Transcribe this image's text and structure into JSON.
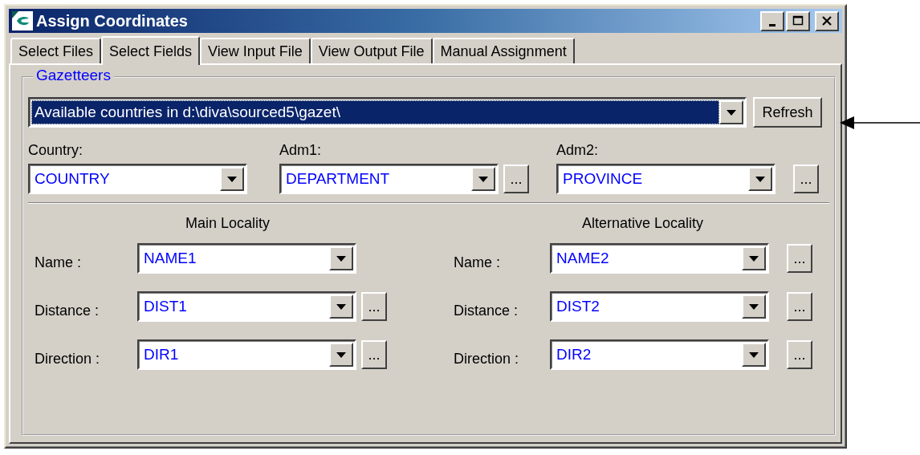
{
  "window": {
    "title": "Assign Coordinates"
  },
  "tabs": [
    {
      "label": "Select Files",
      "selected": false
    },
    {
      "label": "Select Fields",
      "selected": true
    },
    {
      "label": "View Input File",
      "selected": false
    },
    {
      "label": "View Output File",
      "selected": false
    },
    {
      "label": "Manual Assignment",
      "selected": false
    }
  ],
  "gazetteers": {
    "legend": "Gazetteers",
    "source": {
      "value": "Available countries in d:\\diva\\sourced5\\gazet\\",
      "focused": true
    },
    "refresh": "Refresh"
  },
  "admin": [
    {
      "label": "Country:",
      "value": "COUNTRY"
    },
    {
      "label": "Adm1:",
      "value": "DEPARTMENT",
      "browse": "..."
    },
    {
      "label": "Adm2:",
      "value": "PROVINCE",
      "browse": "..."
    }
  ],
  "localities": [
    {
      "heading": "Main Locality",
      "fields": [
        {
          "label": "Name :",
          "value": "NAME1"
        },
        {
          "label": "Distance :",
          "value": "DIST1",
          "browse": "..."
        },
        {
          "label": "Direction :",
          "value": "DIR1",
          "browse": "..."
        }
      ]
    },
    {
      "heading": "Alternative Locality",
      "fields": [
        {
          "label": "Name :",
          "value": "NAME2",
          "browse": "..."
        },
        {
          "label": "Distance :",
          "value": "DIST2",
          "browse": "..."
        },
        {
          "label": "Direction :",
          "value": "DIR2",
          "browse": "..."
        }
      ]
    }
  ]
}
